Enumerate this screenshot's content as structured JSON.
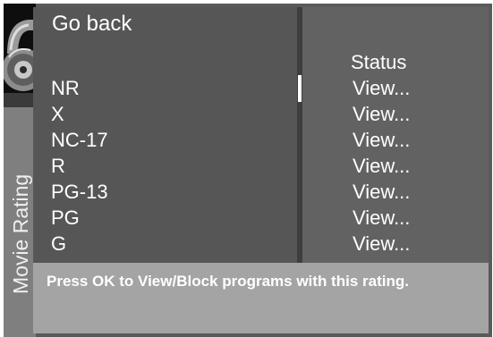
{
  "side_title": "Movie Rating",
  "menu": {
    "go_back_label": "Go back",
    "status_header": "Status",
    "ratings": [
      {
        "label": "NR",
        "status": "View..."
      },
      {
        "label": "X",
        "status": "View..."
      },
      {
        "label": "NC-17",
        "status": "View..."
      },
      {
        "label": "R",
        "status": "View..."
      },
      {
        "label": "PG-13",
        "status": "View..."
      },
      {
        "label": "PG",
        "status": "View..."
      },
      {
        "label": "G",
        "status": "View..."
      }
    ]
  },
  "help_text": "Press OK to View/Block programs with this rating.",
  "icons": {
    "logo": "padlock-icon"
  },
  "colors": {
    "screen_bg": "#5a5a5a",
    "help_bar_bg": "#a4a4a4",
    "text": "#ffffff"
  }
}
